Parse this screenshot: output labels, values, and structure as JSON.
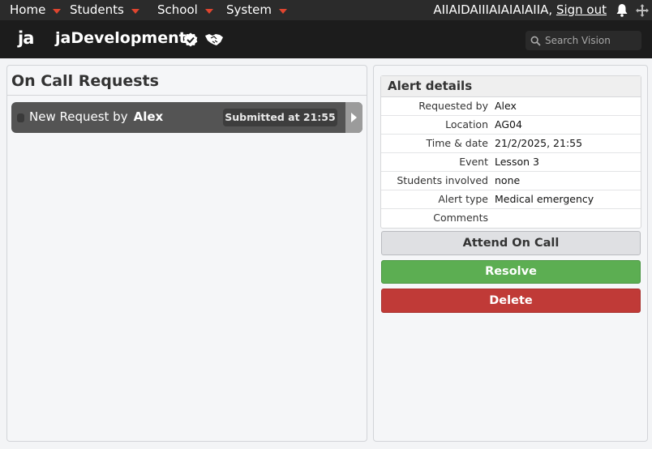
{
  "topbar": {
    "menu": [
      {
        "label": "Home"
      },
      {
        "label": "Students"
      },
      {
        "label": "School"
      },
      {
        "label": "System"
      }
    ],
    "user_name": "AIIAIDAIIIAIAIAIAIIA,",
    "sign_out": "Sign out"
  },
  "header": {
    "logo": "ja",
    "app_title": "jaDevelopment",
    "search_placeholder": "Search Vision"
  },
  "left_panel": {
    "title": "On Call Requests",
    "request": {
      "prefix": "New Request by",
      "name": "Alex",
      "submitted": "Submitted at 21:55"
    }
  },
  "right_panel": {
    "details_title": "Alert details",
    "rows": [
      {
        "label": "Requested by",
        "value": "Alex"
      },
      {
        "label": "Location",
        "value": "AG04"
      },
      {
        "label": "Time & date",
        "value": "21/2/2025, 21:55"
      },
      {
        "label": "Event",
        "value": "Lesson 3"
      },
      {
        "label": "Students involved",
        "value": "none"
      },
      {
        "label": "Alert type",
        "value": "Medical emergency"
      },
      {
        "label": "Comments",
        "value": ""
      }
    ],
    "buttons": {
      "attend": "Attend On Call",
      "resolve": "Resolve",
      "delete": "Delete"
    }
  },
  "colors": {
    "accent_caret": "#e0452f",
    "resolve": "#5cae52",
    "delete": "#c03a37"
  },
  "icons": [
    "caret-down-icon",
    "bell-icon",
    "move-icon",
    "verified-icon",
    "handshake-icon",
    "search-icon",
    "chevron-right-icon"
  ]
}
